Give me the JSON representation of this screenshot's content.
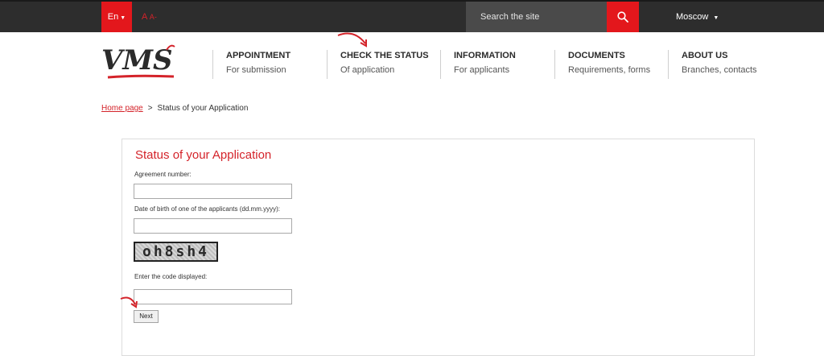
{
  "topbar": {
    "language": "En",
    "font_size_large": "A",
    "font_size_small": "A",
    "font_size_minus": "-",
    "search_placeholder": "Search the site",
    "city": "Moscow"
  },
  "logo": {
    "text": "VMS"
  },
  "nav": [
    {
      "title": "APPOINTMENT",
      "subtitle": "For submission"
    },
    {
      "title": "CHECK THE STATUS",
      "subtitle": "Of application"
    },
    {
      "title": "INFORMATION",
      "subtitle": "For applicants"
    },
    {
      "title": "DOCUMENTS",
      "subtitle": "Requirements, forms"
    },
    {
      "title": "ABOUT US",
      "subtitle": "Branches, contacts"
    }
  ],
  "breadcrumb": {
    "home": "Home page",
    "separator": ">",
    "current": "Status of your Application"
  },
  "form": {
    "title": "Status of your Application",
    "agreement_label": "Agreement number:",
    "agreement_value": "",
    "dob_label": "Date of birth of one of the applicants (dd.mm.yyyy):",
    "dob_value": "",
    "captcha_text": "oh8sh4",
    "code_label": "Enter the code displayed:",
    "code_value": "",
    "next_label": "Next"
  },
  "colors": {
    "accent": "#e3171c",
    "topbar": "#2d2d2d",
    "search_bg": "#4a4a4a"
  }
}
